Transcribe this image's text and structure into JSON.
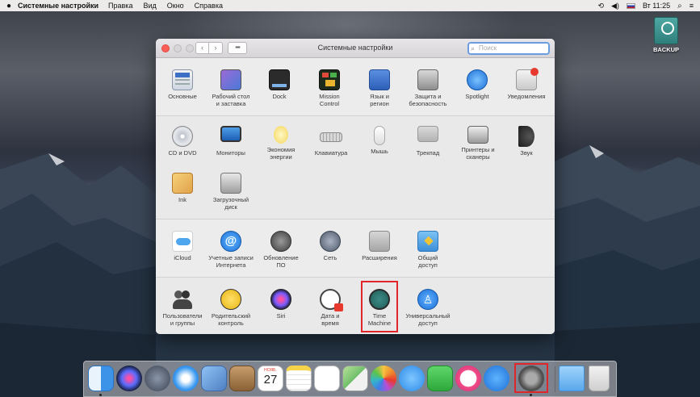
{
  "menubar": {
    "apple_icon": "apple-logo",
    "app_name": "Системные настройки",
    "menus": [
      "Правка",
      "Вид",
      "Окно",
      "Справка"
    ],
    "clock": "Вт 11:25",
    "status_icons": [
      "time-machine-icon",
      "volume-icon",
      "input-flag-icon",
      "search-icon",
      "list-icon"
    ]
  },
  "desktop": {
    "disk_label": "BACKUP"
  },
  "window": {
    "title": "Системные настройки",
    "search_placeholder": "Поиск",
    "back_glyph": "‹",
    "forward_glyph": "›",
    "grid_glyph": "▪▪▪",
    "sections": [
      [
        "Основные",
        "Рабочий стол\nи заставка",
        "Dock",
        "Mission\nControl",
        "Язык и\nрегион",
        "Защита и\nбезопасность",
        "Spotlight",
        "Уведомления"
      ],
      [
        "CD и DVD",
        "Мониторы",
        "Экономия\nэнергии",
        "Клавиатура",
        "Мышь",
        "Трекпад",
        "Принтеры и\nсканеры",
        "Звук",
        "Ink",
        "Загрузочный\nдиск"
      ],
      [
        "iCloud",
        "Учетные записи\nИнтернета",
        "Обновление\nПО",
        "Сеть",
        "Расширения",
        "Общий\nдоступ"
      ],
      [
        "Пользователи\nи группы",
        "Родительский\nконтроль",
        "Siri",
        "Дата и\nвремя",
        "Time\nMachine",
        "Универсальный\nдоступ"
      ]
    ],
    "highlighted": "Time Machine"
  },
  "dock": {
    "apps": [
      "finder",
      "siri",
      "launchpad",
      "safari",
      "preview-photo",
      "contacts",
      "calendar",
      "notes",
      "reminders",
      "maps",
      "photos",
      "messages",
      "facetime",
      "itunes",
      "app-store",
      "system-preferences",
      "downloads",
      "trash"
    ],
    "calendar_month": "НОЯБ.",
    "calendar_day": "27",
    "highlighted": "system-preferences"
  },
  "colors": {
    "highlight": "#e0262b",
    "search_focus": "#6c9de3"
  }
}
